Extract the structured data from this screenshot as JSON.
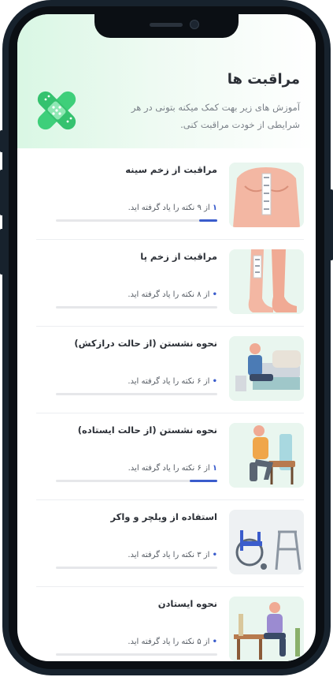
{
  "header": {
    "title": "مراقبت ها",
    "subtitle": "آموزش های زیر بهت کمک میکنه بتونی در هر شرایطی از خودت مراقبت کنی."
  },
  "progress_template": "از {total} نکته را یاد گرفته اید.",
  "items": [
    {
      "title": "مراقبت از زخم سینه",
      "learned": "۱",
      "total": "۹",
      "progress_text": "از ۹ نکته را یاد گرفته اید.",
      "fraction": 0.11,
      "image": "chest-wound-icon"
    },
    {
      "title": "مراقبت از زخم پا",
      "learned": "۰",
      "total": "۸",
      "progress_text": "از ۸ نکته را یاد گرفته اید.",
      "fraction": 0,
      "image": "leg-wound-icon"
    },
    {
      "title": "نحوه نشستن (از حالت درازکش)",
      "learned": "۰",
      "total": "۶",
      "progress_text": "از ۶ نکته را یاد گرفته اید.",
      "fraction": 0,
      "image": "sitting-from-lying-icon"
    },
    {
      "title": "نحوه نشستن (از حالت ایستاده)",
      "learned": "۱",
      "total": "۶",
      "progress_text": "از ۶ نکته را یاد گرفته اید.",
      "fraction": 0.17,
      "image": "sitting-from-standing-icon"
    },
    {
      "title": "استفاده از ویلچر و واکر",
      "learned": "۰",
      "total": "۳",
      "progress_text": "از ۳ نکته را یاد گرفته اید.",
      "fraction": 0,
      "image": "wheelchair-walker-icon"
    },
    {
      "title": "نحوه ایستادن",
      "learned": "۰",
      "total": "۵",
      "progress_text": "از ۵ نکته را یاد گرفته اید.",
      "fraction": 0,
      "image": "standing-up-icon"
    }
  ],
  "colors": {
    "accent": "#3a5ccc",
    "header_green": "#d9f7e4",
    "bandage": "#3ecf7a"
  }
}
